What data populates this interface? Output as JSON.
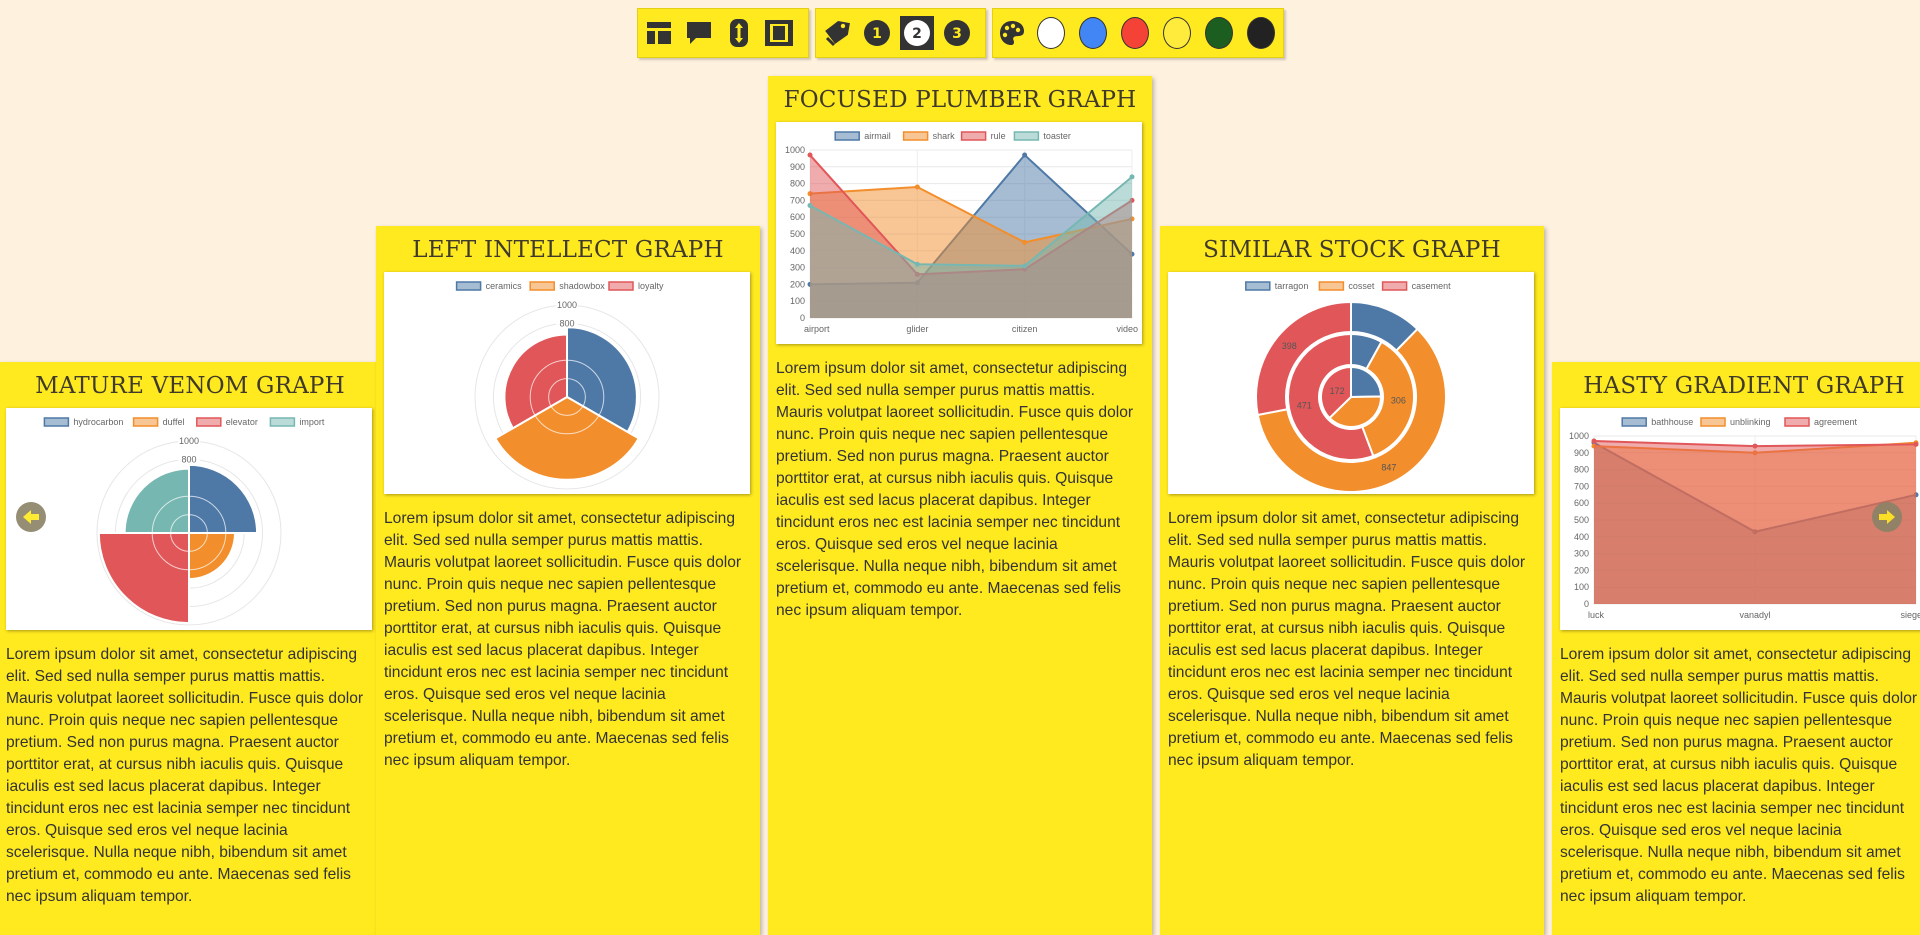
{
  "toolbar": {
    "group1": [
      "layout-icon",
      "comment-icon",
      "resize-vertical-icon",
      "fullscreen-icon"
    ],
    "group2": {
      "icon": "tag-icon",
      "numbers": [
        "1",
        "2",
        "3"
      ],
      "selected": "2"
    },
    "group3": {
      "icon": "palette-icon",
      "swatches": [
        "#ffffff",
        "#4285f4",
        "#f44336",
        "#ffeb3b",
        "#1b5e20",
        "#222222"
      ]
    }
  },
  "lorem": "Lorem ipsum dolor sit amet, consectetur adipiscing elit. Sed sed nulla semper purus mattis mattis. Mauris volutpat laoreet sollicitudin. Fusce quis dolor nunc. Proin quis neque nec sapien pellentesque pretium. Sed non purus magna. Praesent auctor porttitor erat, at cursus nibh iaculis quis. Quisque iaculis est sed lacus placerat dapibus. Integer tincidunt eros nec est lacinia semper nec tincidunt eros. Quisque sed eros vel neque lacinia scelerisque. Nulla neque nibh, bibendum sit amet pretium et, commodo eu ante. Maecenas sed felis nec ipsum aliquam tempor.",
  "cards": [
    {
      "title": "MATURE VENOM GRAPH"
    },
    {
      "title": "LEFT INTELLECT GRAPH"
    },
    {
      "title": "FOCUSED PLUMBER GRAPH"
    },
    {
      "title": "SIMILAR STOCK GRAPH"
    },
    {
      "title": "HASTY GRADIENT GRAPH"
    }
  ],
  "colors": {
    "blue": "#4e79a7",
    "orange": "#f28e2b",
    "red": "#e15759",
    "teal": "#76b7b2",
    "card": "#ffe91f",
    "bg": "#fef1de"
  },
  "chart_data": [
    {
      "type": "polarArea",
      "legend": [
        "hydrocarbon",
        "duffel",
        "elevator",
        "import"
      ],
      "values": [
        740,
        500,
        980,
        700
      ],
      "rticks": [
        "1000",
        "800"
      ],
      "rmax": 1000
    },
    {
      "type": "polarArea",
      "legend": [
        "ceramics",
        "shadowbox",
        "loyalty"
      ],
      "values": [
        760,
        900,
        680
      ],
      "rticks": [
        "1000",
        "800"
      ],
      "rmax": 1000
    },
    {
      "type": "area",
      "legend": [
        "airmail",
        "shark",
        "rule",
        "toaster"
      ],
      "categories": [
        "airport",
        "glider",
        "citizen",
        "video"
      ],
      "yticks": [
        "1000",
        "900",
        "800",
        "700",
        "600",
        "500",
        "400",
        "300",
        "200",
        "100",
        "0"
      ],
      "ylim": [
        0,
        1000
      ],
      "series": [
        {
          "name": "airmail",
          "values": [
            200,
            210,
            970,
            380
          ]
        },
        {
          "name": "shark",
          "values": [
            740,
            780,
            450,
            590
          ]
        },
        {
          "name": "rule",
          "values": [
            970,
            260,
            290,
            700
          ]
        },
        {
          "name": "toaster",
          "values": [
            670,
            320,
            310,
            840
          ]
        }
      ]
    },
    {
      "type": "doughnut",
      "legend": [
        "tarragon",
        "cosset",
        "casement"
      ],
      "rings": [
        {
          "values": [
            175,
            847,
            398
          ],
          "labels": [
            "",
            "847",
            "398"
          ]
        },
        {
          "values": [
            68,
            306,
            471
          ],
          "labels": [
            "",
            "306",
            "471"
          ]
        },
        {
          "values": [
            114,
            175,
            172
          ],
          "labels": [
            "",
            "",
            "172"
          ]
        }
      ]
    },
    {
      "type": "area",
      "legend": [
        "bathhouse",
        "unblinking",
        "agreement"
      ],
      "categories": [
        "luck",
        "vanadyl",
        "siege"
      ],
      "yticks": [
        "1000",
        "900",
        "800",
        "700",
        "600",
        "500",
        "400",
        "300",
        "200",
        "100",
        "0"
      ],
      "ylim": [
        0,
        1000
      ],
      "series": [
        {
          "name": "bathhouse",
          "values": [
            960,
            430,
            650
          ]
        },
        {
          "name": "unblinking",
          "values": [
            940,
            900,
            960
          ]
        },
        {
          "name": "agreement",
          "values": [
            970,
            940,
            950
          ]
        }
      ]
    }
  ]
}
